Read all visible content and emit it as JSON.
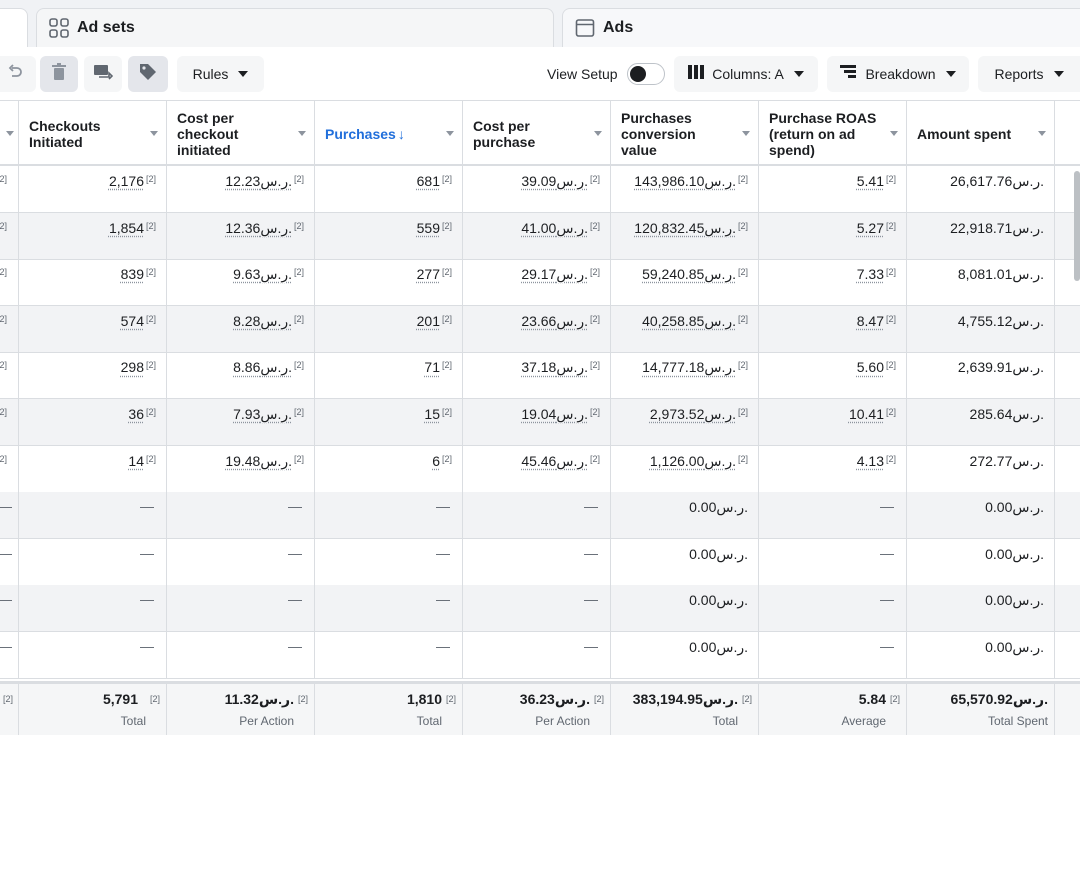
{
  "tabs": {
    "adsets": "Ad sets",
    "ads": "Ads"
  },
  "toolbar": {
    "rules": "Rules",
    "view_setup": "View Setup",
    "columns": "Columns: A",
    "breakdown": "Breakdown",
    "reports": "Reports"
  },
  "table": {
    "footnote": "[2]",
    "headers": {
      "checkouts": "Checkouts Initiated",
      "cost_checkout": "Cost per checkout initiated",
      "purchases": "Purchases",
      "purchases_arrow": "↓",
      "cost_purchase": "Cost per purchase",
      "conv_value": "Purchases conversion value",
      "roas": "Purchase ROAS (return on ad spend)",
      "spent": "Amount spent"
    },
    "rows": [
      {
        "checkouts": "2,176",
        "cost_checkout": "12.23ر.س.",
        "purchases": "681",
        "cost_purchase": "39.09ر.س.",
        "conv_value": "143,986.10ر.س.",
        "roas": "5.41",
        "spent": "26,617.76ر.س."
      },
      {
        "checkouts": "1,854",
        "cost_checkout": "12.36ر.س.",
        "purchases": "559",
        "cost_purchase": "41.00ر.س.",
        "conv_value": "120,832.45ر.س.",
        "roas": "5.27",
        "spent": "22,918.71ر.س."
      },
      {
        "checkouts": "839",
        "cost_checkout": "9.63ر.س.",
        "purchases": "277",
        "cost_purchase": "29.17ر.س.",
        "conv_value": "59,240.85ر.س.",
        "roas": "7.33",
        "spent": "8,081.01ر.س."
      },
      {
        "checkouts": "574",
        "cost_checkout": "8.28ر.س.",
        "purchases": "201",
        "cost_purchase": "23.66ر.س.",
        "conv_value": "40,258.85ر.س.",
        "roas": "8.47",
        "spent": "4,755.12ر.س."
      },
      {
        "checkouts": "298",
        "cost_checkout": "8.86ر.س.",
        "purchases": "71",
        "cost_purchase": "37.18ر.س.",
        "conv_value": "14,777.18ر.س.",
        "roas": "5.60",
        "spent": "2,639.91ر.س."
      },
      {
        "checkouts": "36",
        "cost_checkout": "7.93ر.س.",
        "purchases": "15",
        "cost_purchase": "19.04ر.س.",
        "conv_value": "2,973.52ر.س.",
        "roas": "10.41",
        "spent": "285.64ر.س."
      },
      {
        "checkouts": "14",
        "cost_checkout": "19.48ر.س.",
        "purchases": "6",
        "cost_purchase": "45.46ر.س.",
        "conv_value": "1,126.00ر.س.",
        "roas": "4.13",
        "spent": "272.77ر.س."
      },
      {
        "checkouts": "—",
        "cost_checkout": "—",
        "purchases": "—",
        "cost_purchase": "—",
        "conv_value": "0.00ر.س.",
        "roas": "—",
        "spent": "0.00ر.س."
      },
      {
        "checkouts": "—",
        "cost_checkout": "—",
        "purchases": "—",
        "cost_purchase": "—",
        "conv_value": "0.00ر.س.",
        "roas": "—",
        "spent": "0.00ر.س."
      },
      {
        "checkouts": "—",
        "cost_checkout": "—",
        "purchases": "—",
        "cost_purchase": "—",
        "conv_value": "0.00ر.س.",
        "roas": "—",
        "spent": "0.00ر.س."
      },
      {
        "checkouts": "—",
        "cost_checkout": "—",
        "purchases": "—",
        "cost_purchase": "—",
        "conv_value": "0.00ر.س.",
        "roas": "—",
        "spent": "0.00ر.س."
      }
    ],
    "totals": {
      "checkouts": {
        "value": "5,791",
        "label": "Total"
      },
      "cost_checkout": {
        "value": "11.32ر.س.",
        "label": "Per Action"
      },
      "purchases": {
        "value": "1,810",
        "label": "Total"
      },
      "cost_purchase": {
        "value": "36.23ر.س.",
        "label": "Per Action"
      },
      "conv_value": {
        "value": "383,194.95ر.س.",
        "label": "Total"
      },
      "roas": {
        "value": "5.84",
        "label": "Average"
      },
      "spent": {
        "value": "65,570.92ر.س.",
        "label": "Total Spent"
      }
    }
  }
}
